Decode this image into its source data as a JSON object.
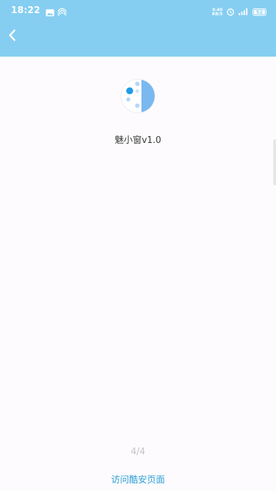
{
  "status_bar": {
    "time": "18:22",
    "net_speed_value": "0.40",
    "net_speed_unit": "KB/S",
    "battery": "52",
    "icons": [
      "image-icon",
      "hotspot-icon",
      "alarm-icon",
      "signal-icon",
      "battery-icon"
    ],
    "color": "#85cef1"
  },
  "app_bar": {
    "back_icon": "chevron-left-icon",
    "color": "#85cef1"
  },
  "about": {
    "app_name": "魅小窗v1.0",
    "logo_icon": "app-logo-icon"
  },
  "pager": {
    "indicator": "4/4"
  },
  "footer": {
    "link_label": "访问酷安页面",
    "link_color": "#2a9fd6"
  }
}
